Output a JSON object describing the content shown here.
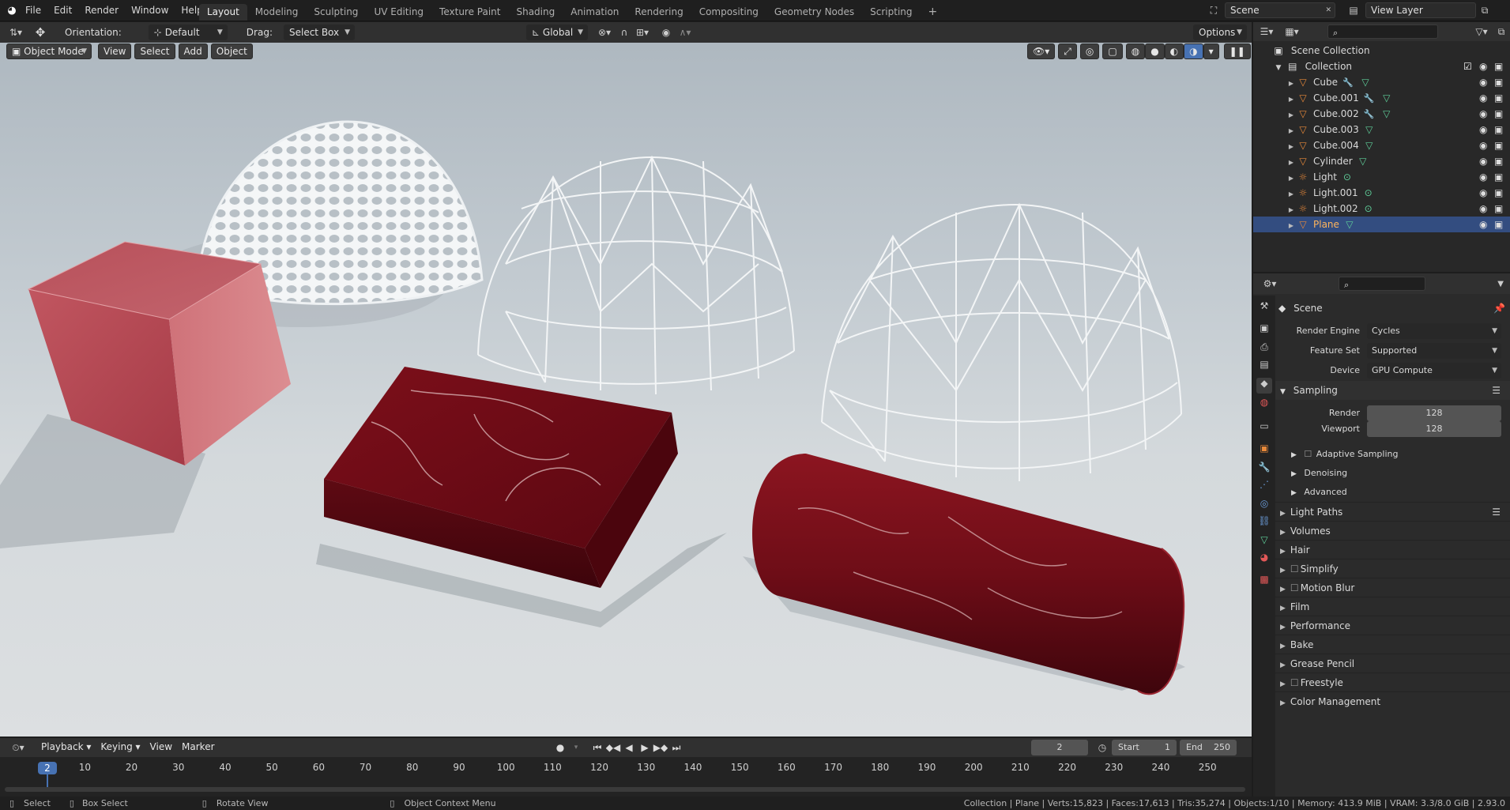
{
  "menu": {
    "items": [
      "File",
      "Edit",
      "Render",
      "Window",
      "Help"
    ]
  },
  "workspaces": [
    "Layout",
    "Modeling",
    "Sculpting",
    "UV Editing",
    "Texture Paint",
    "Shading",
    "Animation",
    "Rendering",
    "Compositing",
    "Geometry Nodes",
    "Scripting"
  ],
  "active_workspace": "Layout",
  "scene_name": "Scene",
  "view_layer": "View Layer",
  "tool_header": {
    "orientation_label": "Orientation:",
    "orientation_value": "Default",
    "drag_label": "Drag:",
    "drag_value": "Select Box",
    "transform_orientation": "Global",
    "options_label": "Options"
  },
  "viewport_header": {
    "mode": "Object Mode",
    "menus": [
      "View",
      "Select",
      "Add",
      "Object"
    ]
  },
  "outliner": {
    "root": "Scene Collection",
    "collection": "Collection",
    "items": [
      {
        "name": "Cube",
        "type": "mesh",
        "modifier": true,
        "selected": false
      },
      {
        "name": "Cube.001",
        "type": "mesh",
        "modifier": true,
        "selected": false
      },
      {
        "name": "Cube.002",
        "type": "mesh",
        "modifier": true,
        "selected": false
      },
      {
        "name": "Cube.003",
        "type": "mesh",
        "modifier": false,
        "selected": false
      },
      {
        "name": "Cube.004",
        "type": "mesh",
        "modifier": false,
        "selected": false
      },
      {
        "name": "Cylinder",
        "type": "mesh",
        "modifier": false,
        "selected": false
      },
      {
        "name": "Light",
        "type": "light",
        "modifier": false,
        "selected": false
      },
      {
        "name": "Light.001",
        "type": "light",
        "modifier": false,
        "selected": false
      },
      {
        "name": "Light.002",
        "type": "light",
        "modifier": false,
        "selected": false
      },
      {
        "name": "Plane",
        "type": "mesh",
        "modifier": false,
        "selected": true
      }
    ]
  },
  "properties": {
    "context": "Scene",
    "render_engine_label": "Render Engine",
    "render_engine": "Cycles",
    "feature_set_label": "Feature Set",
    "feature_set": "Supported",
    "device_label": "Device",
    "device": "GPU Compute",
    "sampling_label": "Sampling",
    "render_label": "Render",
    "render_samples": "128",
    "viewport_label": "Viewport",
    "viewport_samples": "128",
    "sampling_sub": [
      "Adaptive Sampling",
      "Denoising",
      "Advanced"
    ],
    "panels": [
      {
        "label": "Light Paths",
        "checkbox": false
      },
      {
        "label": "Volumes",
        "checkbox": false
      },
      {
        "label": "Hair",
        "checkbox": false
      },
      {
        "label": "Simplify",
        "checkbox": true
      },
      {
        "label": "Motion Blur",
        "checkbox": true
      },
      {
        "label": "Film",
        "checkbox": false
      },
      {
        "label": "Performance",
        "checkbox": false
      },
      {
        "label": "Bake",
        "checkbox": false
      },
      {
        "label": "Grease Pencil",
        "checkbox": false
      },
      {
        "label": "Freestyle",
        "checkbox": true
      },
      {
        "label": "Color Management",
        "checkbox": false
      }
    ]
  },
  "timeline": {
    "menus": [
      "Playback",
      "Keying",
      "View",
      "Marker"
    ],
    "current_frame": "2",
    "start_label": "Start",
    "start": "1",
    "end_label": "End",
    "end": "250",
    "ticks": [
      "10",
      "20",
      "30",
      "40",
      "50",
      "60",
      "70",
      "80",
      "90",
      "100",
      "110",
      "120",
      "130",
      "140",
      "150",
      "160",
      "170",
      "180",
      "190",
      "200",
      "210",
      "220",
      "230",
      "240",
      "250"
    ],
    "playhead": "2"
  },
  "statusbar": {
    "hints": [
      "Select",
      "Box Select",
      "Rotate View",
      "Object Context Menu"
    ],
    "stats": "Collection | Plane | Verts:15,823 | Faces:17,613 | Tris:35,274 | Objects:1/10 | Memory: 413.9 MiB | VRAM: 3.3/8.0 GiB | 2.93.0"
  },
  "colors": {
    "accent": "#4772b3",
    "mesh_icon": "#e8893a",
    "modifier_icon": "#6b9cd9",
    "data_icon": "#5fcf9a"
  }
}
